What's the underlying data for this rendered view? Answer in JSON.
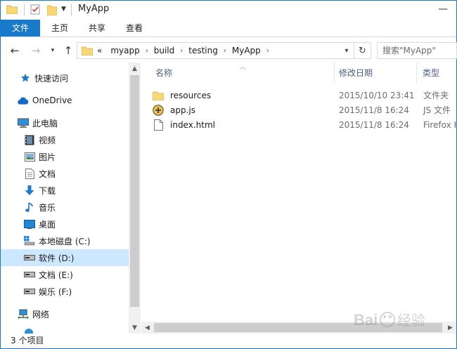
{
  "window": {
    "title": "MyApp"
  },
  "ribbon": {
    "tabs": [
      "文件",
      "主页",
      "共享",
      "查看"
    ]
  },
  "address": {
    "breadcrumb": [
      "«",
      "myapp",
      "build",
      "testing",
      "MyApp"
    ],
    "search_placeholder": "搜索\"MyApp\""
  },
  "nav": {
    "items": [
      {
        "label": "快速访问",
        "icon": "star-icon"
      },
      {
        "label": "OneDrive",
        "icon": "cloud-icon"
      },
      {
        "label": "此电脑",
        "icon": "computer-icon"
      },
      {
        "label": "视频",
        "icon": "video-icon"
      },
      {
        "label": "图片",
        "icon": "pictures-icon"
      },
      {
        "label": "文档",
        "icon": "document-icon"
      },
      {
        "label": "下载",
        "icon": "download-icon"
      },
      {
        "label": "音乐",
        "icon": "music-icon"
      },
      {
        "label": "桌面",
        "icon": "desktop-icon"
      },
      {
        "label": "本地磁盘 (C:)",
        "icon": "drive-icon"
      },
      {
        "label": "软件 (D:)",
        "icon": "drive-icon",
        "selected": true
      },
      {
        "label": "文档 (E:)",
        "icon": "drive-icon"
      },
      {
        "label": "娱乐 (F:)",
        "icon": "drive-icon"
      },
      {
        "label": "网络",
        "icon": "network-icon"
      }
    ]
  },
  "list": {
    "columns": {
      "name": "名称",
      "date": "修改日期",
      "type": "类型"
    },
    "files": [
      {
        "name": "resources",
        "date": "2015/10/10 23:41",
        "type": "文件夹",
        "icon": "folder-icon"
      },
      {
        "name": "app.js",
        "date": "2015/11/8 16:24",
        "type": "JS 文件",
        "icon": "js-file-icon"
      },
      {
        "name": "index.html",
        "date": "2015/11/8 16:24",
        "type": "Firefox H",
        "icon": "html-file-icon"
      }
    ]
  },
  "status": {
    "count": "3 个项目"
  },
  "colors": {
    "accent": "#1979ca",
    "selected": "#cce8ff",
    "folder": "#f8d775",
    "header_text": "#4d6082"
  }
}
